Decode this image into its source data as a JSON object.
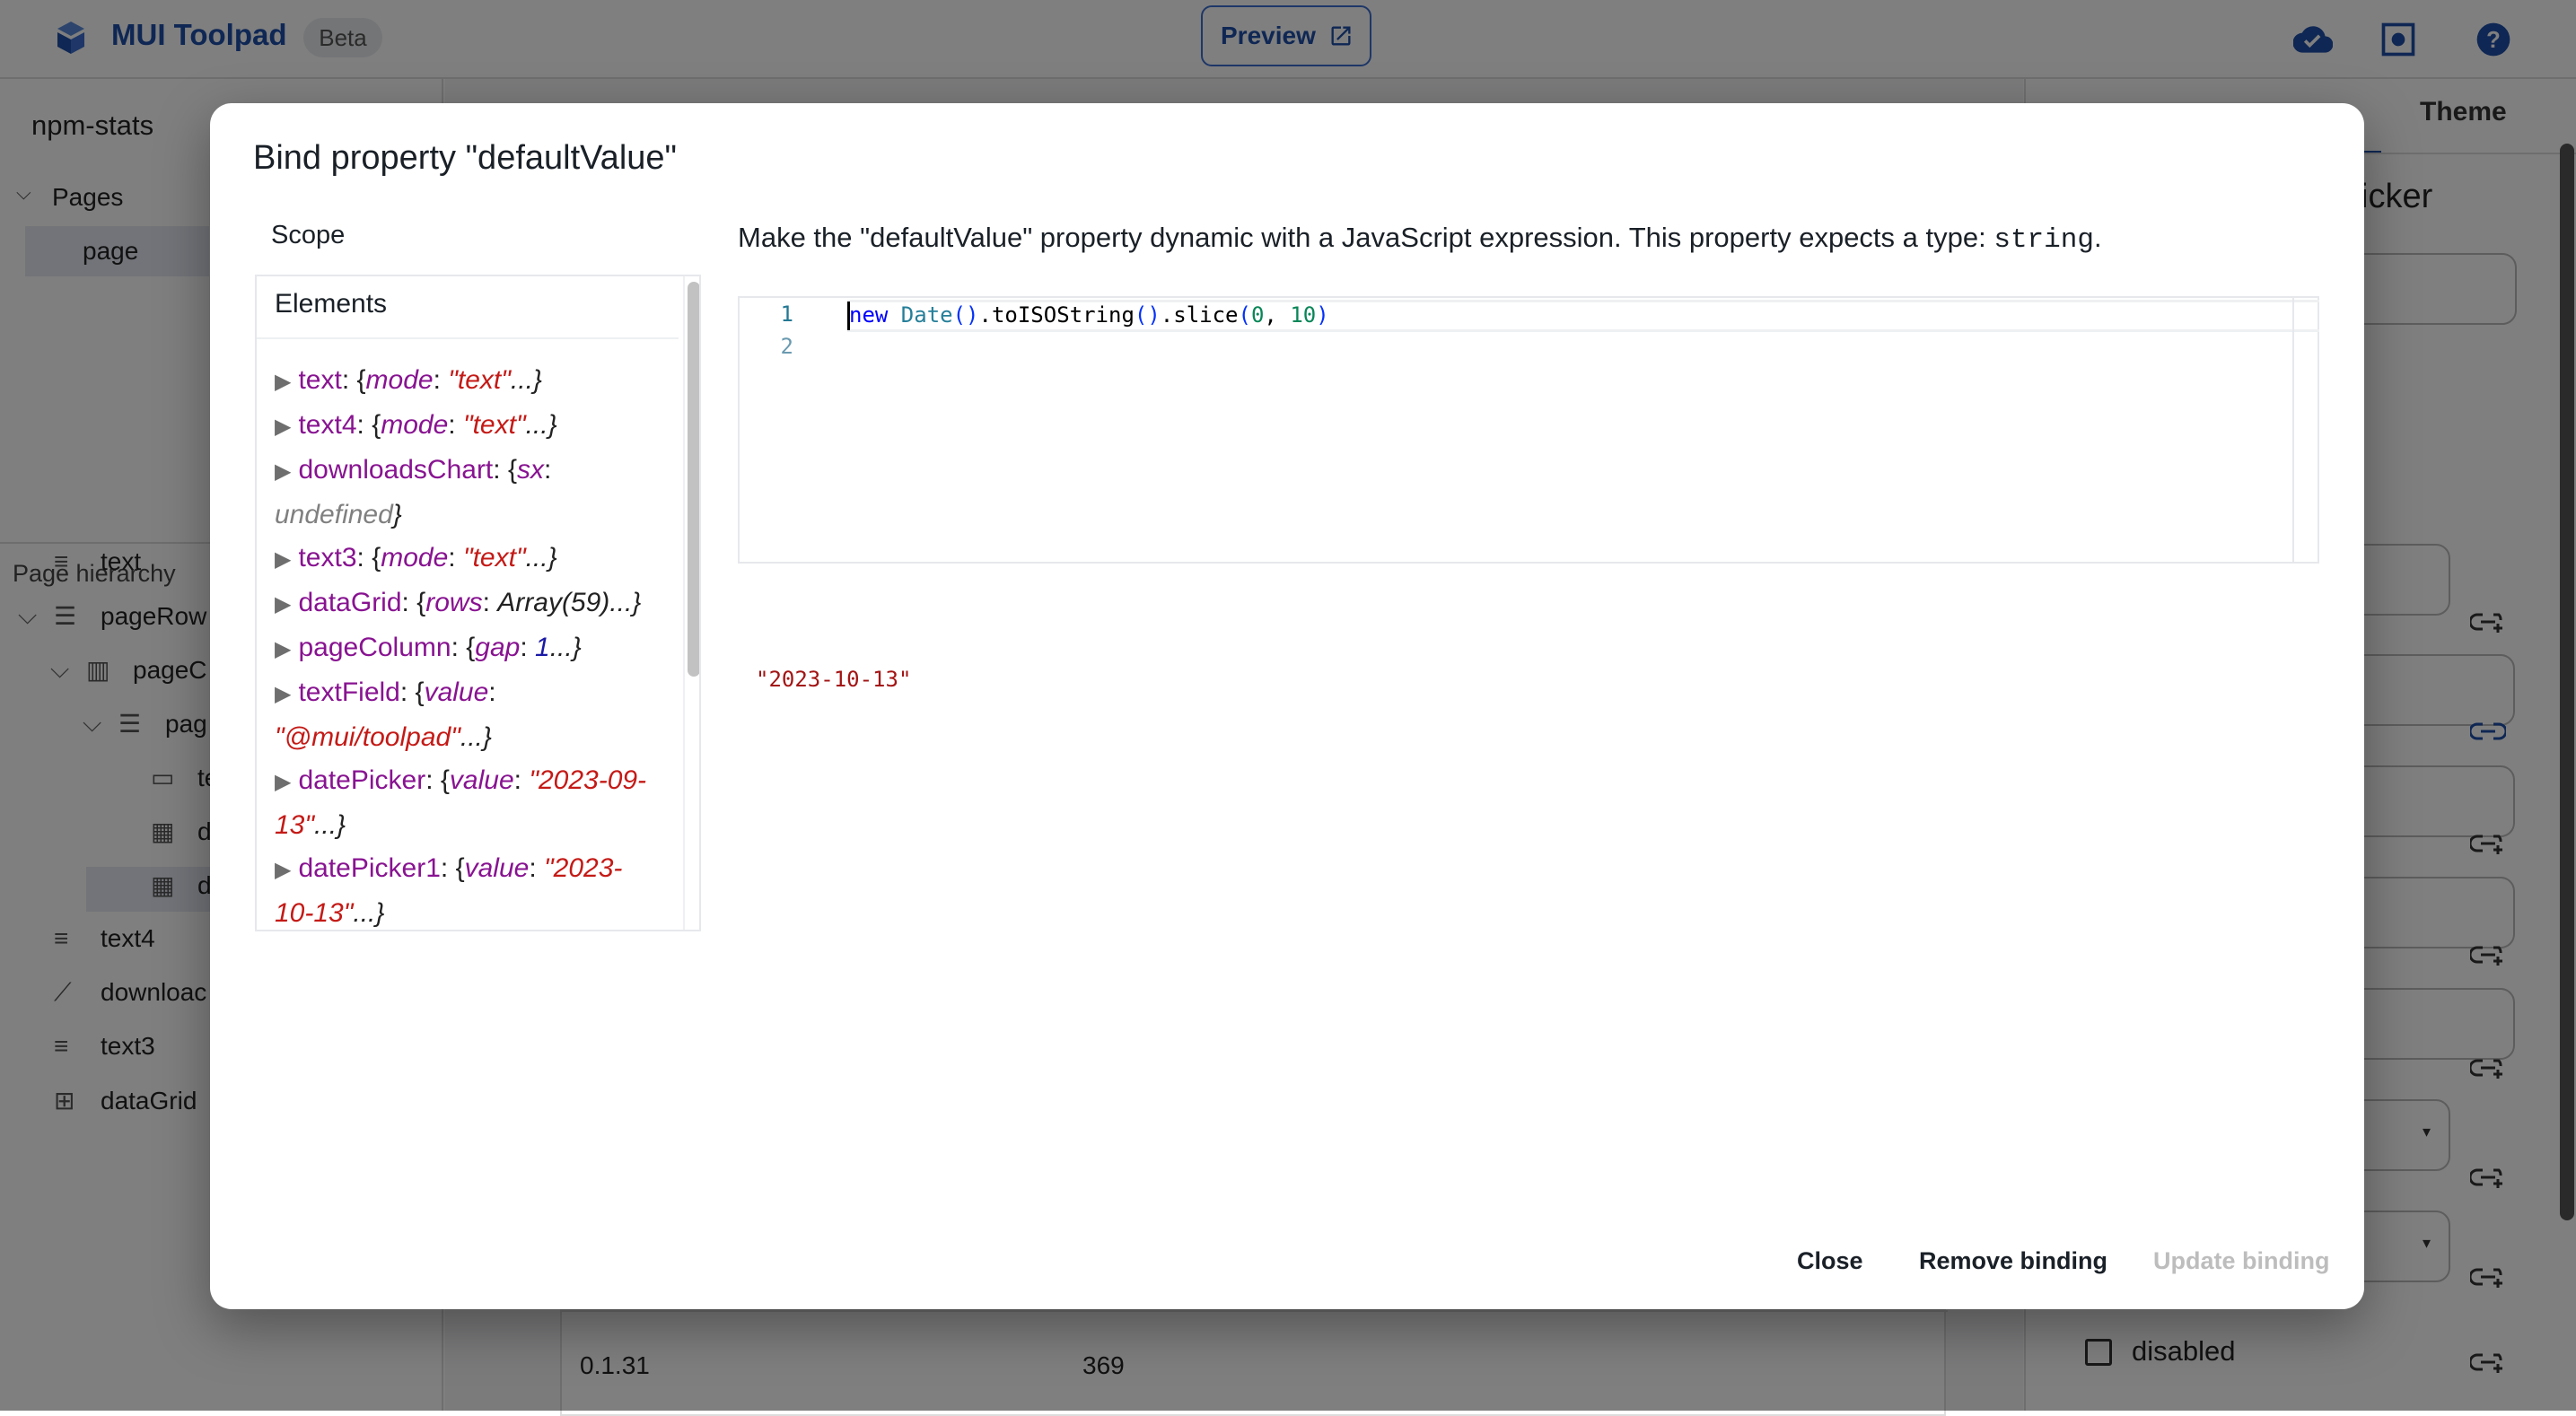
{
  "header": {
    "brand": "MUI Toolpad",
    "badge": "Beta",
    "preview_label": "Preview",
    "icons": [
      "toolpad-logo-icon",
      "cloud-check-icon",
      "theme-toggle-icon",
      "help-icon"
    ],
    "accent": "#1e4fa8"
  },
  "left": {
    "app_name": "npm-stats",
    "pages_label": "Pages",
    "pages": [
      "page"
    ],
    "hierarchy_label": "Page hierarchy",
    "hierarchy": [
      {
        "label": "text",
        "icon": "text-icon"
      },
      {
        "label": "pageRow",
        "icon": "row-icon"
      },
      {
        "label": "pageC",
        "icon": "column-icon"
      },
      {
        "label": "pag",
        "icon": "row-icon"
      },
      {
        "label": "te",
        "icon": "textfield-icon"
      },
      {
        "label": "d",
        "icon": "calendar-icon"
      },
      {
        "label": "d",
        "icon": "calendar-icon"
      },
      {
        "label": "text4",
        "icon": "text-icon"
      },
      {
        "label": "downloac",
        "icon": "chart-icon"
      },
      {
        "label": "text3",
        "icon": "text-icon"
      },
      {
        "label": "dataGrid",
        "icon": "grid-icon"
      }
    ]
  },
  "canvas": {
    "row": [
      "0.1.31",
      "369"
    ]
  },
  "right": {
    "tab_theme": "Theme",
    "component_title": "icker",
    "checkbox_label": "disabled"
  },
  "dialog": {
    "title": "Bind property \"defaultValue\"",
    "scope_label": "Scope",
    "elements_label": "Elements",
    "elements": [
      {
        "name": "text",
        "preview": [
          [
            "{",
            "b"
          ],
          [
            "mode",
            "k i"
          ],
          [
            ": ",
            "b"
          ],
          [
            "\"text\"",
            "s"
          ],
          [
            "...}",
            "b i"
          ]
        ]
      },
      {
        "name": "text4",
        "preview": [
          [
            "{",
            "b"
          ],
          [
            "mode",
            "k i"
          ],
          [
            ": ",
            "b"
          ],
          [
            "\"text\"",
            "s"
          ],
          [
            "...}",
            "b i"
          ]
        ]
      },
      {
        "name": "downloadsChart",
        "preview": [
          [
            "{",
            "b"
          ],
          [
            "sx",
            "k i"
          ],
          [
            ": ",
            "b"
          ],
          [
            "undefined",
            "u"
          ],
          [
            "}",
            "b i"
          ]
        ]
      },
      {
        "name": "text3",
        "preview": [
          [
            "{",
            "b"
          ],
          [
            "mode",
            "k i"
          ],
          [
            ": ",
            "b"
          ],
          [
            "\"text\"",
            "s"
          ],
          [
            "...}",
            "b i"
          ]
        ]
      },
      {
        "name": "dataGrid",
        "preview": [
          [
            "{",
            "b"
          ],
          [
            "rows",
            "k i"
          ],
          [
            ": ",
            "b"
          ],
          [
            "Array(59)",
            "b i"
          ],
          [
            "...}",
            "b i"
          ]
        ]
      },
      {
        "name": "pageColumn",
        "preview": [
          [
            "{",
            "b"
          ],
          [
            "gap",
            "k i"
          ],
          [
            ": ",
            "b"
          ],
          [
            "1",
            "n"
          ],
          [
            "...}",
            "b i"
          ]
        ]
      },
      {
        "name": "textField",
        "preview": [
          [
            "{",
            "b"
          ],
          [
            "value",
            "k i"
          ],
          [
            ": ",
            "b"
          ],
          [
            "\"@mui/toolpad\"",
            "s"
          ],
          [
            "...}",
            "b i"
          ]
        ]
      },
      {
        "name": "datePicker",
        "preview": [
          [
            "{",
            "b"
          ],
          [
            "value",
            "k i"
          ],
          [
            ": ",
            "b"
          ],
          [
            "\"2023-09-13\"",
            "s"
          ],
          [
            "...}",
            "b i"
          ]
        ]
      },
      {
        "name": "datePicker1",
        "preview": [
          [
            "{",
            "b"
          ],
          [
            "value",
            "k i"
          ],
          [
            ": ",
            "b"
          ],
          [
            "\"2023-10-13\"",
            "s"
          ],
          [
            "...}",
            "b i"
          ]
        ]
      }
    ],
    "description": "Make the \"defaultValue\" property dynamic with a JavaScript expression. This property expects a type: ",
    "type": "string",
    "editor": {
      "line_numbers": [
        "1",
        "2"
      ],
      "code": "new Date().toISOString().slice(0, 10)"
    },
    "result": "\"2023-10-13\"",
    "buttons": {
      "close": "Close",
      "remove": "Remove binding",
      "update": "Update binding"
    }
  }
}
